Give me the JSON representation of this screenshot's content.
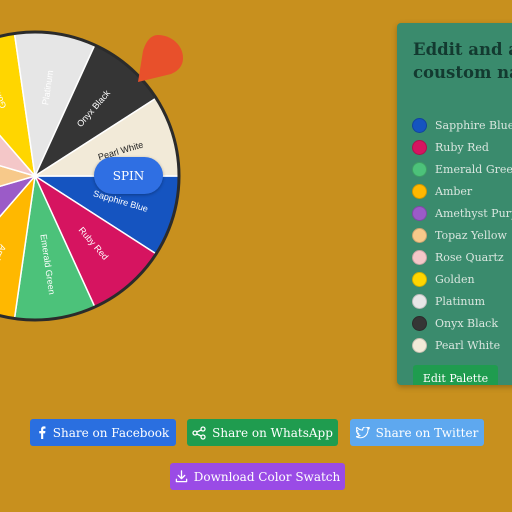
{
  "wheel": {
    "spin_label": "SPIN",
    "segments": [
      {
        "label": "Sapphire Blue",
        "color": "#1554c0",
        "text_color": "#ffffff"
      },
      {
        "label": "Ruby Red",
        "color": "#d61460",
        "text_color": "#ffffff"
      },
      {
        "label": "Emerald Green",
        "color": "#4cc27a",
        "text_color": "#ffffff"
      },
      {
        "label": "Amber",
        "color": "#ffb800",
        "text_color": "#ffffff"
      },
      {
        "label": "Amethyst Purple",
        "color": "#9b5bc8",
        "text_color": "#ffffff"
      },
      {
        "label": "Topaz Yellow",
        "color": "#f7c98a",
        "text_color": "#ffffff"
      },
      {
        "label": "Rose Quartz",
        "color": "#f4c7c8",
        "text_color": "#ffffff"
      },
      {
        "label": "Golden",
        "color": "#ffd600",
        "text_color": "#ffffff"
      },
      {
        "label": "Platinum",
        "color": "#e6e6e6",
        "text_color": "#ffffff"
      },
      {
        "label": "Onyx Black",
        "color": "#353535",
        "text_color": "#ffffff"
      },
      {
        "label": "Pearl White",
        "color": "#f2ead8",
        "text_color": "#222222"
      }
    ],
    "pointer_color": "#e8502b"
  },
  "palette": {
    "title_line1": "Eddit and add",
    "title_line2": "coustom names",
    "colors": [
      {
        "name": "Sapphire Blue",
        "color": "#1554c0"
      },
      {
        "name": "Ruby Red",
        "color": "#d61460"
      },
      {
        "name": "Emerald Green",
        "color": "#4cc27a"
      },
      {
        "name": "Amber",
        "color": "#ffb800"
      },
      {
        "name": "Amethyst Purple",
        "color": "#9b5bc8"
      },
      {
        "name": "Topaz Yellow",
        "color": "#f7c98a"
      },
      {
        "name": "Rose Quartz",
        "color": "#f4c7c8"
      },
      {
        "name": "Golden",
        "color": "#ffd600"
      },
      {
        "name": "Platinum",
        "color": "#e6e6e6"
      },
      {
        "name": "Onyx Black",
        "color": "#353535"
      },
      {
        "name": "Pearl White",
        "color": "#f2ead8"
      }
    ],
    "edit_label": "Edit Palette"
  },
  "share": {
    "facebook_label": "Share on Facebook",
    "whatsapp_label": "Share on WhatsApp",
    "twitter_label": "Share on Twitter",
    "download_label": "Download Color Swatch"
  }
}
